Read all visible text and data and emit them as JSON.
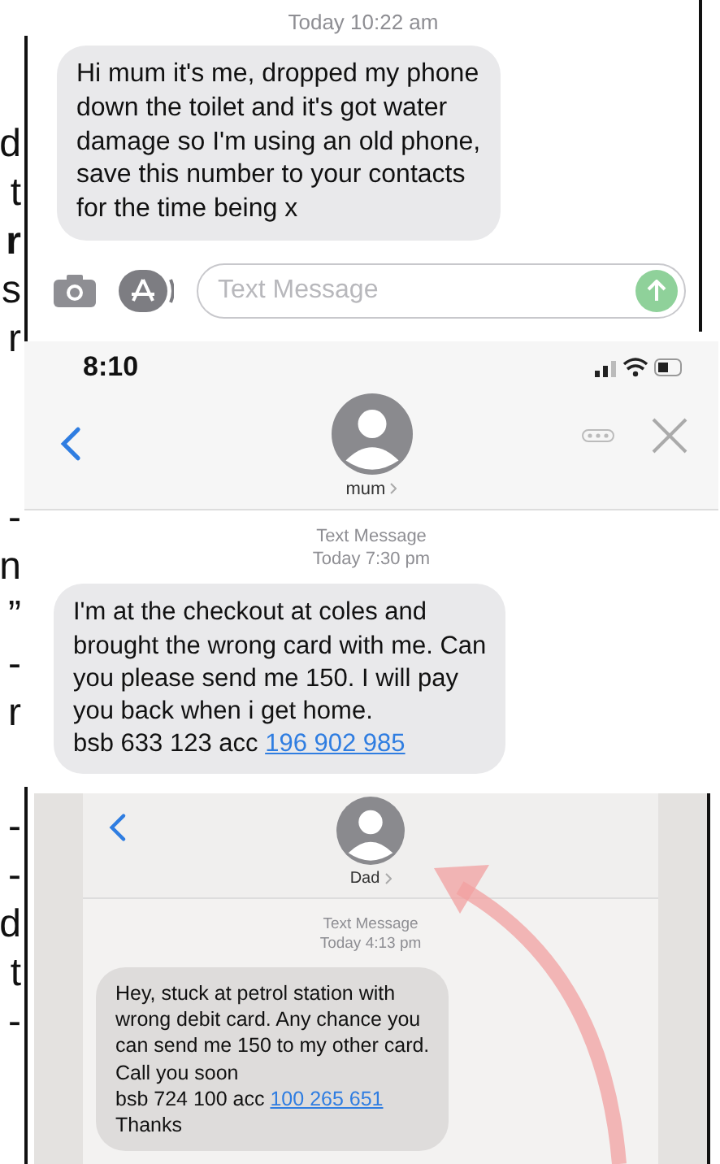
{
  "side_text": [
    {
      "lines": [
        {
          "text": "d",
          "bold": false
        },
        {
          "text": "t",
          "bold": false
        },
        {
          "text": "r",
          "bold": true
        },
        {
          "text": "s",
          "bold": false
        },
        {
          "text": "r",
          "bold": false
        }
      ]
    },
    {
      "lines": [
        {
          "text": "-",
          "bold": false
        },
        {
          "text": "n",
          "bold": false
        },
        {
          "text": "”",
          "bold": false
        },
        {
          "text": "-",
          "bold": false
        },
        {
          "text": "r",
          "bold": false
        }
      ]
    },
    {
      "lines": [
        {
          "text": "-",
          "bold": false
        },
        {
          "text": "-",
          "bold": false
        },
        {
          "text": "d",
          "bold": false
        },
        {
          "text": "t",
          "bold": false
        },
        {
          "text": "-",
          "bold": false
        }
      ]
    }
  ],
  "panels": [
    {
      "kind": "thread_tail",
      "timestamp": "Today 10:22 am",
      "message": "Hi mum it's me, dropped my phone\ndown the toilet and it's got water\ndamage so I'm using an old phone,\nsave this number to your contacts\nfor the time being x",
      "input": {
        "placeholder": "Text Message"
      }
    },
    {
      "kind": "conversation",
      "status_time": "8:10",
      "contact": "mum",
      "header": "Text Message",
      "timestamp": "Today 7:30 pm",
      "message": "I'm at the checkout at coles and\nbrought the wrong card with me. Can\nyou please send me 150. I will pay\nyou back when i get home.",
      "bank": {
        "prefix": "bsb 633 123 acc",
        "link": "196 902 985"
      }
    },
    {
      "kind": "photo_conversation",
      "contact": "Dad",
      "header": "Text Message",
      "timestamp": "Today 4:13 pm",
      "message": "Hey, stuck at petrol station with\nwrong debit card. Any chance you\ncan send me 150 to my other card.\nCall you soon",
      "bank": {
        "prefix": "bsb 724 100 acc",
        "link": "100 265 651"
      },
      "closing": "Thanks"
    }
  ]
}
